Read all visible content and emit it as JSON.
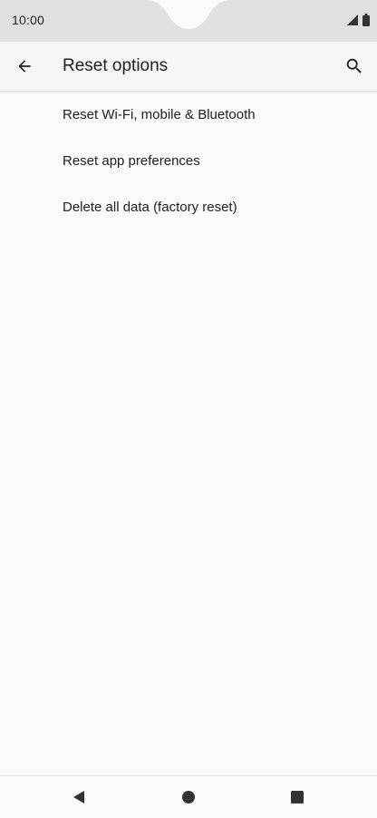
{
  "status_bar": {
    "time": "10:00",
    "icons": [
      "signal-icon",
      "battery-icon"
    ]
  },
  "app_bar": {
    "title": "Reset options",
    "back_icon": "arrow-back-icon",
    "search_icon": "search-icon"
  },
  "reset_options": [
    {
      "label": "Reset Wi-Fi, mobile & Bluetooth"
    },
    {
      "label": "Reset app preferences"
    },
    {
      "label": "Delete all data (factory reset)"
    }
  ],
  "navigation_bar": {
    "buttons": [
      "back-triangle-icon",
      "home-circle-icon",
      "recents-square-icon"
    ]
  },
  "colors": {
    "status_bar_bg": "#e0e0e0",
    "app_bar_bg": "#f5f5f5",
    "page_bg": "#fafafa",
    "text_primary": "#202124"
  }
}
